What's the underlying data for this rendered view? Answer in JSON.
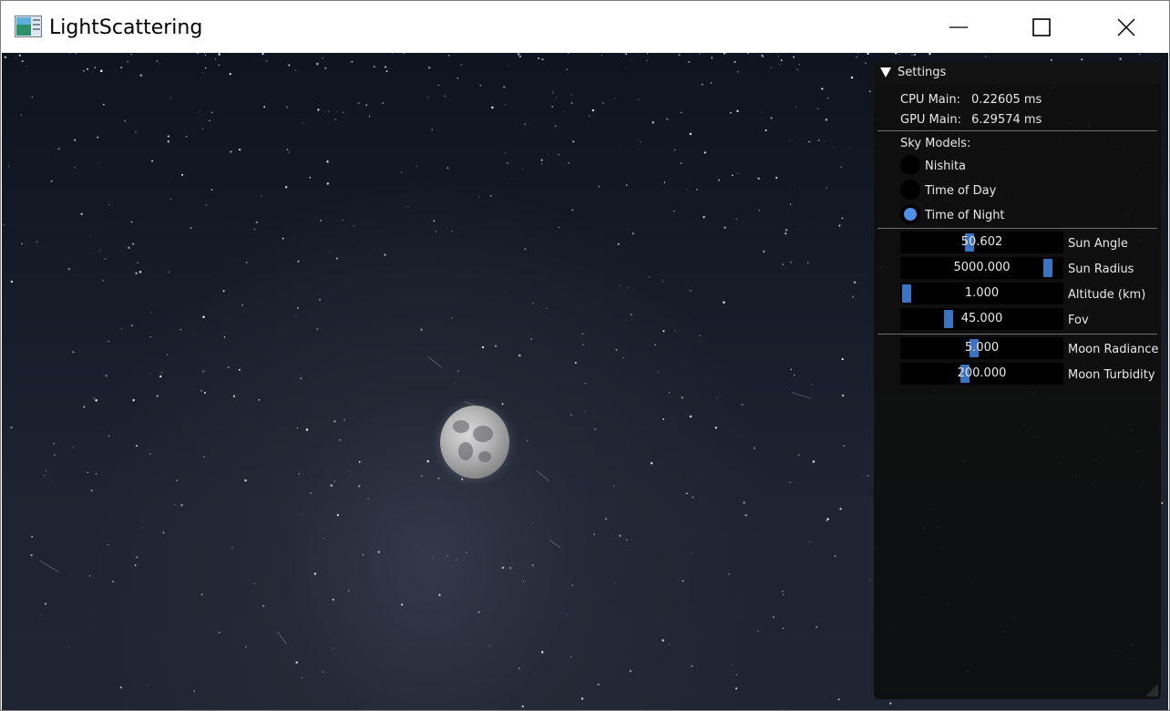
{
  "window": {
    "title": "LightScattering",
    "controls": [
      "minimize",
      "maximize",
      "close"
    ]
  },
  "panel": {
    "title": "Settings",
    "stats": [
      {
        "label": "CPU Main:",
        "value": "0.22605 ms"
      },
      {
        "label": "GPU Main:",
        "value": "6.29574 ms"
      }
    ],
    "sky_models": {
      "title": "Sky Models:",
      "options": [
        {
          "label": "Nishita",
          "selected": false
        },
        {
          "label": "Time of Day",
          "selected": false
        },
        {
          "label": "Time of Night",
          "selected": true
        }
      ]
    },
    "sliders": [
      {
        "label": "Sun Angle",
        "value": "50.602",
        "fraction": 0.42
      },
      {
        "label": "Sun Radius",
        "value": "5000.000",
        "fraction": 0.94
      },
      {
        "label": "Altitude (km)",
        "value": "1.000",
        "fraction": 0.0
      },
      {
        "label": "Fov",
        "value": "45.000",
        "fraction": 0.28
      }
    ],
    "moon_sliders": [
      {
        "label": "Moon Radiance",
        "value": "5.000",
        "fraction": 0.45
      },
      {
        "label": "Moon Turbidity",
        "value": "200.000",
        "fraction": 0.39
      }
    ]
  },
  "colors": {
    "accent": "#3b73c0",
    "radio_on": "#4f8fe6",
    "panel_bg": "#0f0f0f",
    "sky": "#151b27"
  },
  "icons": {
    "app": "app-window-icon",
    "collapse": "triangle-down-icon"
  }
}
